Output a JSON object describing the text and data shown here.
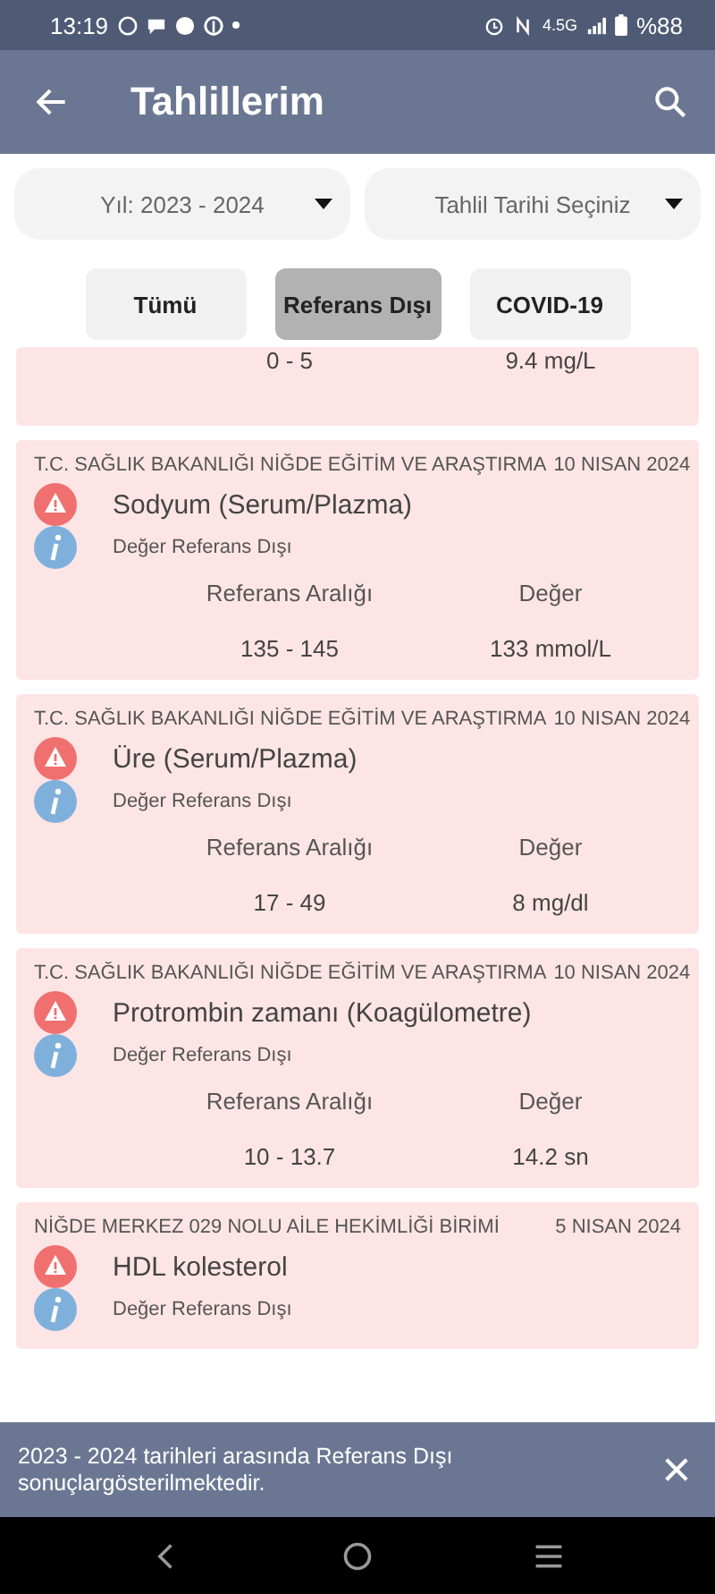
{
  "status_bar": {
    "time": "13:19",
    "network": "4.5G",
    "battery": "%88"
  },
  "app_bar": {
    "title": "Tahlillerim"
  },
  "filters": [
    {
      "label": "Yıl: 2023 - 2024"
    },
    {
      "label": "Tahlil Tarihi Seçiniz"
    }
  ],
  "tabs": [
    {
      "label": "Tümü",
      "selected": false
    },
    {
      "label": "Referans Dışı",
      "selected": true
    },
    {
      "label": "COVID-19",
      "selected": false
    }
  ],
  "results": [
    {
      "range": "0 - 5",
      "value": "9.4 mg/L"
    },
    {
      "institution": "T.C. SAĞLIK BAKANLIĞI NİĞDE EĞİTİM VE ARAŞTIRMA",
      "date": "10 NISAN 2024",
      "name": "Sodyum (Serum/Plazma)",
      "status": "Değer Referans Dışı",
      "range_label": "Referans Aralığı",
      "value_label": "Değer",
      "range": "135 - 145",
      "value": "133 mmol/L"
    },
    {
      "institution": "T.C. SAĞLIK BAKANLIĞI NİĞDE EĞİTİM VE ARAŞTIRMA",
      "date": "10 NISAN 2024",
      "name": "Üre (Serum/Plazma)",
      "status": "Değer Referans Dışı",
      "range_label": "Referans Aralığı",
      "value_label": "Değer",
      "range": "17 - 49",
      "value": "8 mg/dl"
    },
    {
      "institution": "T.C. SAĞLIK BAKANLIĞI NİĞDE EĞİTİM VE ARAŞTIRMA",
      "date": "10 NISAN 2024",
      "name": "Protrombin zamanı (Koagülometre)",
      "status": "Değer Referans Dışı",
      "range_label": "Referans Aralığı",
      "value_label": "Değer",
      "range": "10 - 13.7",
      "value": "14.2 sn"
    },
    {
      "institution": "NİĞDE MERKEZ 029 NOLU AİLE HEKİMLİĞİ BİRİMİ",
      "date": "5 NISAN 2024",
      "name": "HDL kolesterol",
      "status": "Değer Referans Dışı"
    }
  ],
  "snackbar": {
    "message": "2023 - 2024 tarihleri arasında Referans Dışı sonuçlargösterilmektedir."
  }
}
